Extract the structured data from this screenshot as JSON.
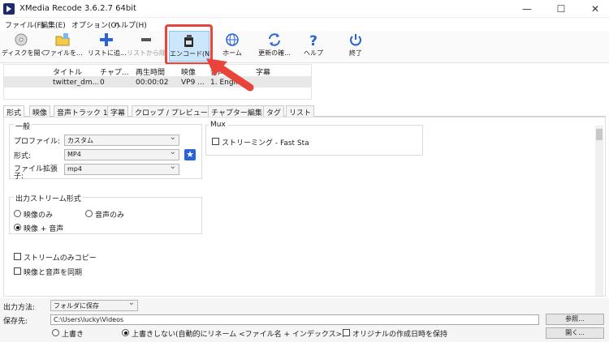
{
  "window": {
    "title": "XMedia Recode 3.6.2.7 64bit",
    "minimize": "—",
    "maximize": "☐",
    "close": "✕"
  },
  "menu": [
    "ファイル(F)",
    "編集(E)",
    "オプション(O)",
    "ヘルプ(H)"
  ],
  "toolbar": {
    "open_disc": "ディスクを開く",
    "open_file": "ファイルを...",
    "add_list": "リストに追...",
    "remove_list": "リストから除",
    "encode": "エンコード(N)",
    "home": "ホーム",
    "update": "更新の確...",
    "help": "ヘルプ",
    "exit": "終了"
  },
  "grid": {
    "headers": [
      "タイトル",
      "チャプ...",
      "再生時間",
      "映像",
      "音声",
      "字幕"
    ],
    "row": [
      "twitter_dm....",
      "0",
      "00:00:02",
      "VP9 ...",
      "1. Engli...",
      ""
    ]
  },
  "tabs": [
    "形式",
    "映像",
    "音声トラック 1",
    "字幕",
    "クロップ / プレビュー",
    "チャプター編集",
    "タグ",
    "リスト"
  ],
  "format_tab": {
    "general_label": "一般",
    "profile_label": "プロファイル:",
    "profile_value": "カスタム",
    "format_label": "形式:",
    "format_value": "MP4",
    "ext_label_1": "ファイル拡張",
    "ext_label_2": "子:",
    "ext_value": "mp4",
    "mux_label": "Mux",
    "streaming_label": "ストリーミング - Fast Sta",
    "output_stream_label": "出力ストリーム形式",
    "video_only": "映像のみ",
    "audio_only": "音声のみ",
    "video_audio": "映像 + 音声",
    "stream_copy": "ストリームのみコピー",
    "sync_av": "映像と音声を同期"
  },
  "bottom": {
    "output_method_label": "出力方法:",
    "output_method_value": "フォルダに保存",
    "save_to_label": "保存先:",
    "save_path": "C:\\Users\\lucky\\Videos",
    "browse": "参照...",
    "open": "開く...",
    "overwrite": "上書き",
    "no_overwrite": "上書きしない(自動的にリネーム <ファイル名 + インデックス>)",
    "keep_date": "オリジナルの作成日時を保持"
  },
  "colors": {
    "highlight": "#e8443a",
    "selected": "#cce6fb",
    "accent": "#2a62d8"
  }
}
